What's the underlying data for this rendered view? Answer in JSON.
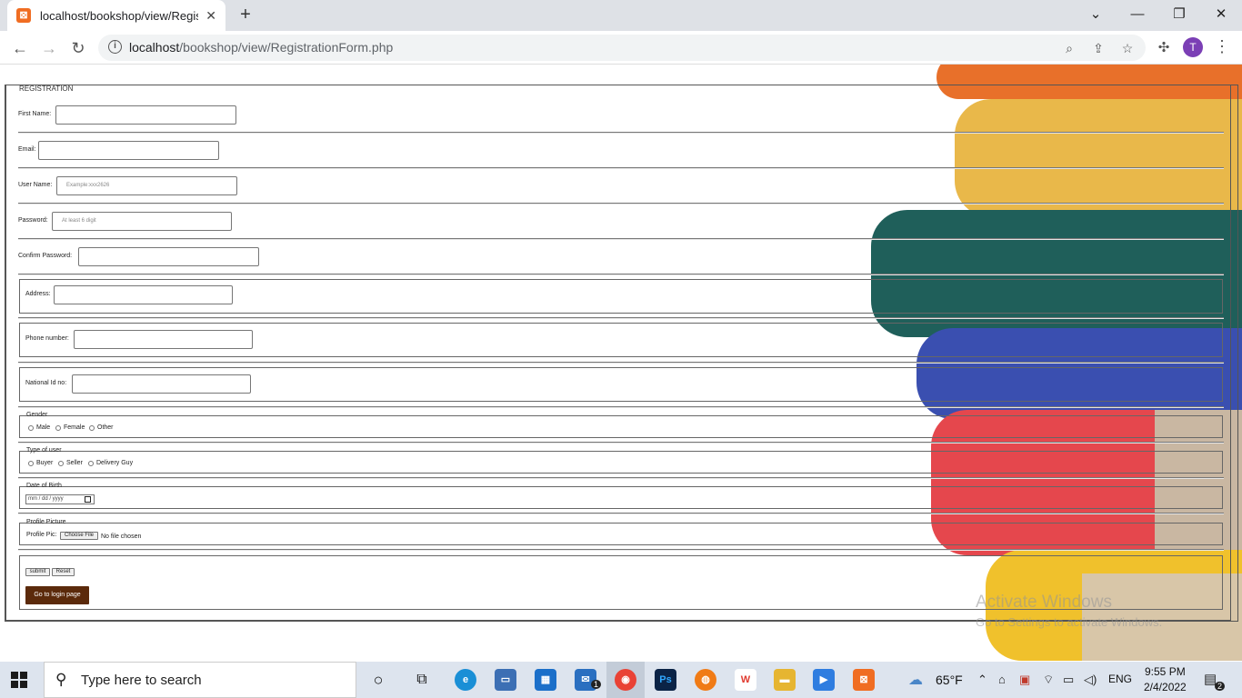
{
  "browser": {
    "tab_title": "localhost/bookshop/view/Registr",
    "tab_close": "✕",
    "new_tab": "+",
    "url_host": "localhost",
    "url_path": "/bookshop/view/RegistrationForm.php",
    "profile_initial": "T"
  },
  "form": {
    "legend": "REGISTRATION",
    "first_name_label": "First Name:",
    "email_label": "Email:",
    "user_name_label": "User Name:",
    "user_name_placeholder": "Example:xxx2626",
    "password_label": "Password:",
    "password_placeholder": "At least 6 digit",
    "confirm_password_label": "Confirm Password:",
    "address_label": "Address:",
    "phone_label": "Phone number:",
    "nid_label": "National Id no:",
    "gender": {
      "legend": "Gender",
      "options": [
        "Male",
        "Female",
        "Other"
      ]
    },
    "user_type": {
      "legend": "Type of user",
      "options": [
        "Buyer",
        "Seller",
        "Delivery Guy"
      ]
    },
    "dob": {
      "legend": "Date of Birth",
      "value": "mm / dd / yyyy"
    },
    "profile": {
      "legend": "Profile Picture",
      "label": "Profile Pic:",
      "choose_button": "Choose File",
      "status": "No file chosen"
    },
    "submit_label": "submit",
    "reset_label": "Reset",
    "login_button": "Go to login page"
  },
  "watermark": {
    "line1": "Activate Windows",
    "line2": "Go to Settings to activate Windows."
  },
  "taskbar": {
    "search_placeholder": "Type here to search",
    "weather": "65°F",
    "language": "ENG",
    "time": "9:55 PM",
    "date": "2/4/2022",
    "notification_count": "2",
    "mail_badge": "1"
  },
  "colors": {
    "login_button_bg": "#5b2a0b",
    "tab_favicon": "#f06d22",
    "avatar": "#7b3fb5"
  }
}
